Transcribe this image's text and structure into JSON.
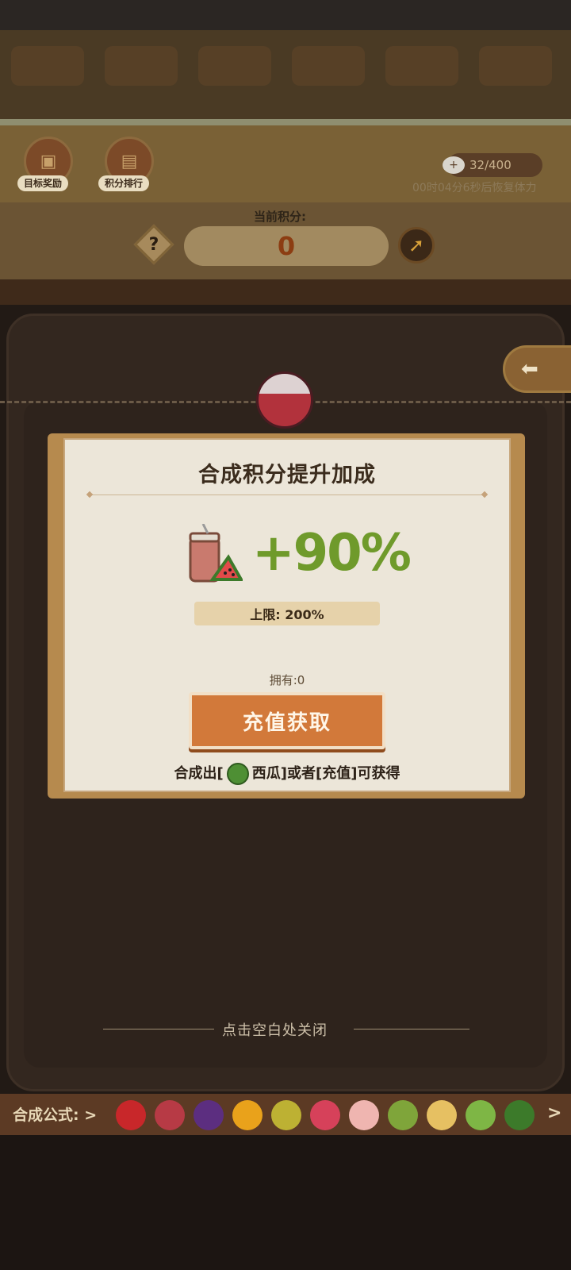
{
  "header": {
    "goal_reward_label": "目标奖励",
    "score_rank_label": "积分排行",
    "stamina": "32/400",
    "recover_text": "00时04分6秒后恢复体力",
    "current_score_label": "当前积分:",
    "current_score": "0"
  },
  "dialog": {
    "title": "合成积分提升加成",
    "bonus": "+90%",
    "limit": "上限: 200%",
    "owned": "拥有:0",
    "recharge_button": "充值获取",
    "source_prefix": "合成出[",
    "source_fruit": "西瓜]或者[充值]可获得"
  },
  "close_hint": "点击空白处关闭",
  "formula": {
    "label": "合成公式:",
    "fruits": [
      {
        "name": "cherry",
        "color": "#c8272a"
      },
      {
        "name": "lychee",
        "color": "#b73a45"
      },
      {
        "name": "grape",
        "color": "#5c2e80"
      },
      {
        "name": "orange",
        "color": "#e9a21b"
      },
      {
        "name": "lemon",
        "color": "#bdb133"
      },
      {
        "name": "apple",
        "color": "#d6415a"
      },
      {
        "name": "peach",
        "color": "#efb5b0"
      },
      {
        "name": "kiwi",
        "color": "#7fa53a"
      },
      {
        "name": "mango",
        "color": "#e6c062"
      },
      {
        "name": "melon",
        "color": "#7eb645"
      },
      {
        "name": "watermelon",
        "color": "#3c7a2a"
      }
    ]
  },
  "colors": {
    "accent_green": "#6f9a2b",
    "button_orange": "#d2793a"
  }
}
